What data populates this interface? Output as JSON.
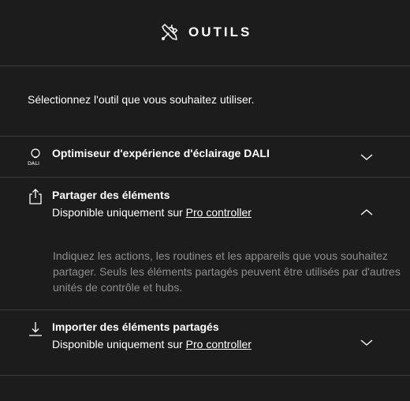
{
  "header": {
    "title": "OUTILS",
    "icon": "tools-icon"
  },
  "intro": "Sélectionnez l'outil que vous souhaitez utiliser.",
  "items": [
    {
      "title": "Optimiseur d'expérience d'éclairage DALI",
      "icon": "dali-bulb-icon",
      "icon_label": "DALI",
      "expanded": false
    },
    {
      "title": "Partager des éléments",
      "subtitle_prefix": "Disponible uniquement sur",
      "subtitle_link": "Pro controller",
      "icon": "share-icon",
      "expanded": true,
      "description": "Indiquez les actions, les routines et les appareils que vous souhaitez partager. Seuls les éléments partagés peuvent être utilisés par d'autres unités de contrôle et hubs."
    },
    {
      "title": "Importer des éléments partagés",
      "subtitle_prefix": "Disponible uniquement sur",
      "subtitle_link": "Pro controller",
      "icon": "import-icon",
      "expanded": false
    }
  ]
}
